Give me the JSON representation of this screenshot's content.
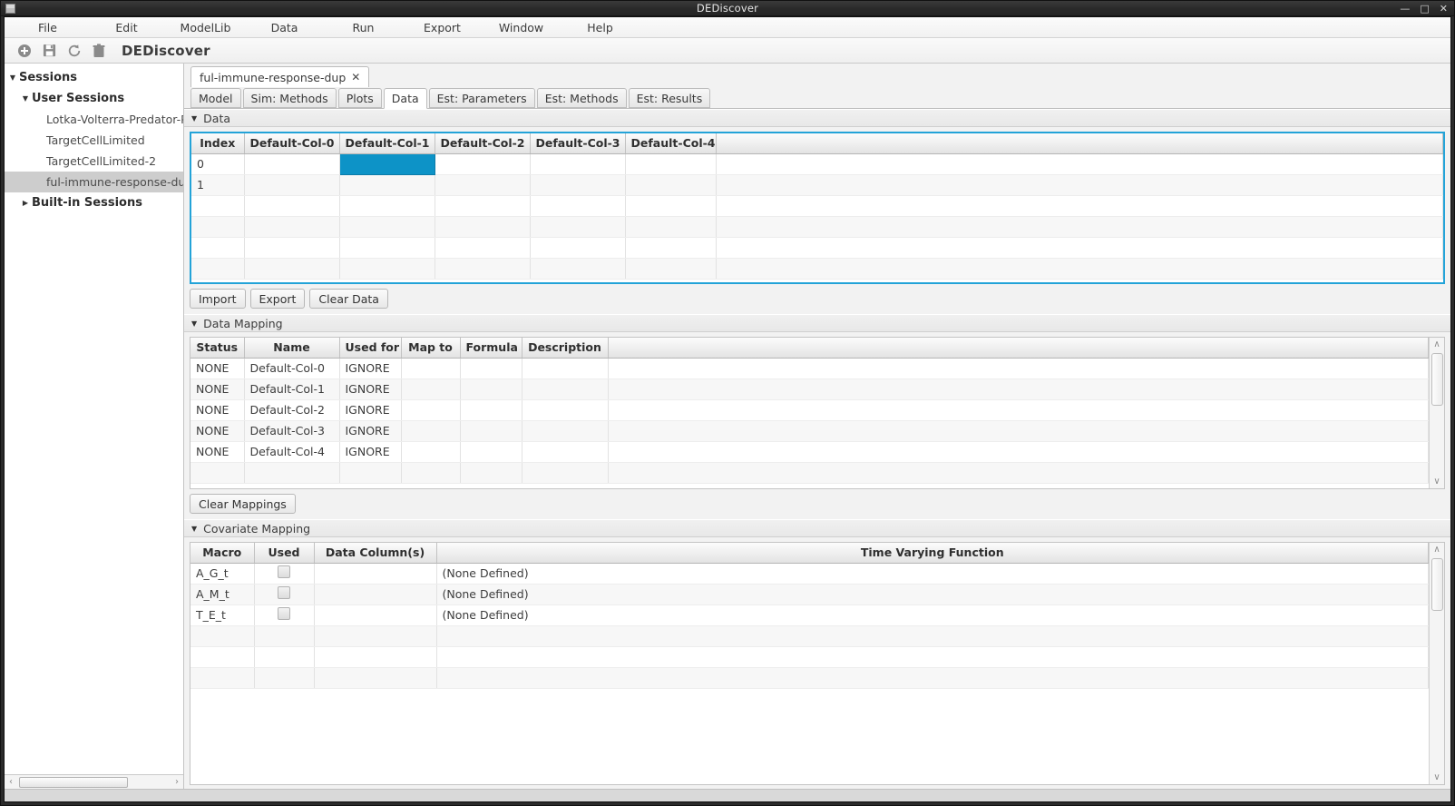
{
  "window": {
    "title": "DEDiscover",
    "icon": "window-icon",
    "controls": {
      "minimize": "—",
      "maximize": "□",
      "close": "✕"
    }
  },
  "menubar": {
    "items": [
      {
        "label": "File"
      },
      {
        "label": "Edit"
      },
      {
        "label": "ModelLib"
      },
      {
        "label": "Data"
      },
      {
        "label": "Run"
      },
      {
        "label": "Export"
      },
      {
        "label": "Window"
      },
      {
        "label": "Help"
      }
    ]
  },
  "toolbar": {
    "brand": "DEDiscover",
    "icons": [
      "add-icon",
      "save-icon",
      "refresh-icon",
      "delete-icon"
    ]
  },
  "sidebar": {
    "tree": [
      {
        "label": "Sessions",
        "level": 0,
        "expanded": true,
        "twisty": "▼",
        "selected": false
      },
      {
        "label": "User Sessions",
        "level": 1,
        "expanded": true,
        "twisty": "▼",
        "selected": false
      },
      {
        "label": "Lotka-Volterra-Predator-Prey",
        "level": 2,
        "expanded": null,
        "twisty": "",
        "selected": false
      },
      {
        "label": "TargetCellLimited",
        "level": 2,
        "expanded": null,
        "twisty": "",
        "selected": false
      },
      {
        "label": "TargetCellLimited-2",
        "level": 2,
        "expanded": null,
        "twisty": "",
        "selected": false
      },
      {
        "label": "ful-immune-response-dup",
        "level": 2,
        "expanded": null,
        "twisty": "",
        "selected": true
      },
      {
        "label": "Built-in Sessions",
        "level": 1,
        "expanded": false,
        "twisty": "▶",
        "selected": false
      }
    ],
    "hscroll": {
      "left_arrow": "‹",
      "right_arrow": "›"
    }
  },
  "document_tabs": [
    {
      "label": "ful-immune-response-dup",
      "close": "✕",
      "active": true
    }
  ],
  "sub_tabs": [
    {
      "label": "Model",
      "active": false
    },
    {
      "label": "Sim: Methods",
      "active": false
    },
    {
      "label": "Plots",
      "active": false
    },
    {
      "label": "Data",
      "active": true
    },
    {
      "label": "Est: Parameters",
      "active": false
    },
    {
      "label": "Est: Methods",
      "active": false
    },
    {
      "label": "Est: Results",
      "active": false
    }
  ],
  "sections": {
    "data": {
      "title": "Data",
      "twisty": "▼",
      "columns": [
        "Index",
        "Default-Col-0",
        "Default-Col-1",
        "Default-Col-2",
        "Default-Col-3",
        "Default-Col-4",
        ""
      ],
      "rows": [
        [
          "0",
          "",
          "",
          "",
          "",
          "",
          ""
        ],
        [
          "1",
          "",
          "",
          "",
          "",
          "",
          ""
        ],
        [
          "",
          "",
          "",
          "",
          "",
          "",
          ""
        ],
        [
          "",
          "",
          "",
          "",
          "",
          "",
          ""
        ],
        [
          "",
          "",
          "",
          "",
          "",
          "",
          ""
        ],
        [
          "",
          "",
          "",
          "",
          "",
          "",
          ""
        ]
      ],
      "selected_cell": {
        "row": 0,
        "col": 2
      },
      "selection_color": "#0d93c7",
      "buttons": [
        {
          "label": "Import"
        },
        {
          "label": "Export"
        },
        {
          "label": "Clear Data"
        }
      ]
    },
    "data_mapping": {
      "title": "Data Mapping",
      "twisty": "▼",
      "columns": [
        "Status",
        "Name",
        "Used for",
        "Map to",
        "Formula",
        "Description",
        ""
      ],
      "rows": [
        [
          "NONE",
          "Default-Col-0",
          "IGNORE",
          "",
          "",
          "",
          ""
        ],
        [
          "NONE",
          "Default-Col-1",
          "IGNORE",
          "",
          "",
          "",
          ""
        ],
        [
          "NONE",
          "Default-Col-2",
          "IGNORE",
          "",
          "",
          "",
          ""
        ],
        [
          "NONE",
          "Default-Col-3",
          "IGNORE",
          "",
          "",
          "",
          ""
        ],
        [
          "NONE",
          "Default-Col-4",
          "IGNORE",
          "",
          "",
          "",
          ""
        ],
        [
          "",
          "",
          "",
          "",
          "",
          "",
          ""
        ]
      ],
      "buttons": [
        {
          "label": "Clear Mappings"
        }
      ],
      "scrollbar": {
        "up": "∧",
        "down": "∨"
      }
    },
    "covariate_mapping": {
      "title": "Covariate Mapping",
      "twisty": "▼",
      "columns": [
        "Macro",
        "Used",
        "Data Column(s)",
        "Time Varying Function"
      ],
      "rows": [
        {
          "macro": "A_G_t",
          "used": false,
          "data_columns": "",
          "time_varying_function": "(None Defined)"
        },
        {
          "macro": "A_M_t",
          "used": false,
          "data_columns": "",
          "time_varying_function": "(None Defined)"
        },
        {
          "macro": "T_E_t",
          "used": false,
          "data_columns": "",
          "time_varying_function": "(None Defined)"
        },
        {
          "macro": "",
          "used": null,
          "data_columns": "",
          "time_varying_function": ""
        },
        {
          "macro": "",
          "used": null,
          "data_columns": "",
          "time_varying_function": ""
        },
        {
          "macro": "",
          "used": null,
          "data_columns": "",
          "time_varying_function": ""
        }
      ],
      "scrollbar": {
        "up": "∧",
        "down": "∨"
      }
    }
  }
}
